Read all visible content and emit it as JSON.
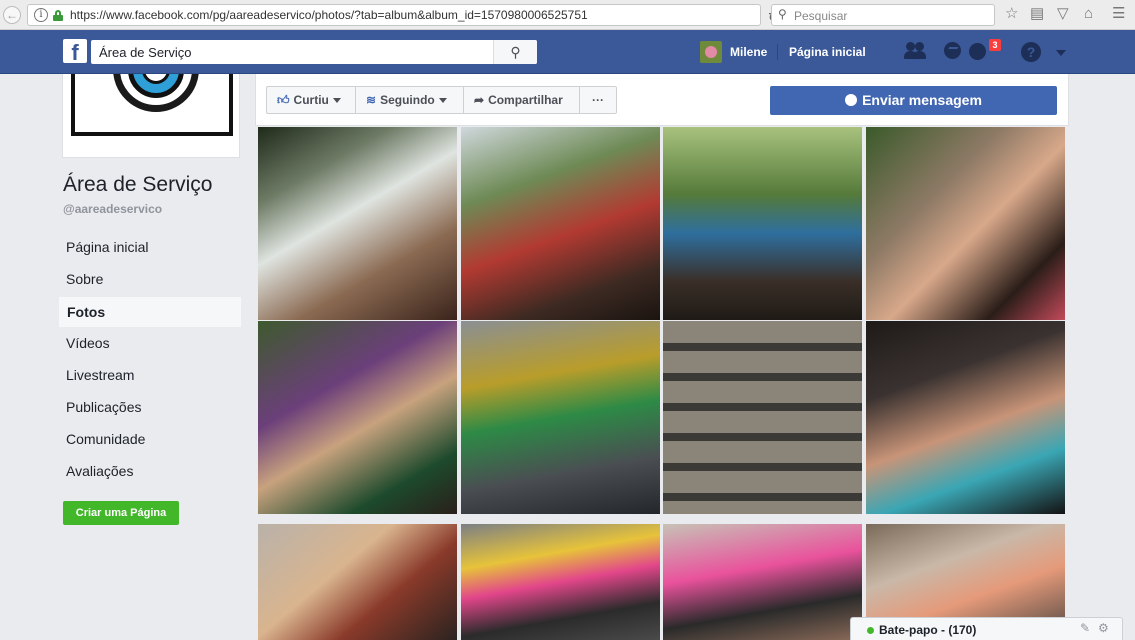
{
  "browser": {
    "url": "https://www.facebook.com/pg/aareadeservico/photos/?tab=album&album_id=1570980006525751",
    "search_placeholder": "Pesquisar"
  },
  "fb_header": {
    "search_value": "Área de Serviço",
    "user_name": "Milene",
    "home_label": "Página inicial",
    "notification_count": "3"
  },
  "page": {
    "title": "Área de Serviço",
    "handle": "@aareadeservico"
  },
  "sidebar": {
    "items": [
      {
        "label": "Página inicial"
      },
      {
        "label": "Sobre"
      },
      {
        "label": "Fotos"
      },
      {
        "label": "Vídeos"
      },
      {
        "label": "Livestream"
      },
      {
        "label": "Publicações"
      },
      {
        "label": "Comunidade"
      },
      {
        "label": "Avaliações"
      }
    ],
    "create_page_label": "Criar uma Página"
  },
  "actions": {
    "like_label": "Curtiu",
    "follow_label": "Seguindo",
    "share_label": "Compartilhar",
    "more_label": "···",
    "send_message_label": "Enviar mensagem"
  },
  "chat": {
    "label": "Bate-papo - (170)"
  }
}
